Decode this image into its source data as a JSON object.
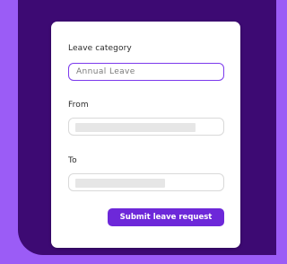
{
  "form": {
    "category_label": "Leave category",
    "category_value": "Annual Leave",
    "from_label": "From",
    "from_value": "",
    "to_label": "To",
    "to_value": "",
    "submit_label": "Submit leave request"
  },
  "colors": {
    "page_background": "#9b5cf6",
    "panel_background": "#3d0a73",
    "accent": "#7c3aed",
    "button": "#6d28d9"
  }
}
